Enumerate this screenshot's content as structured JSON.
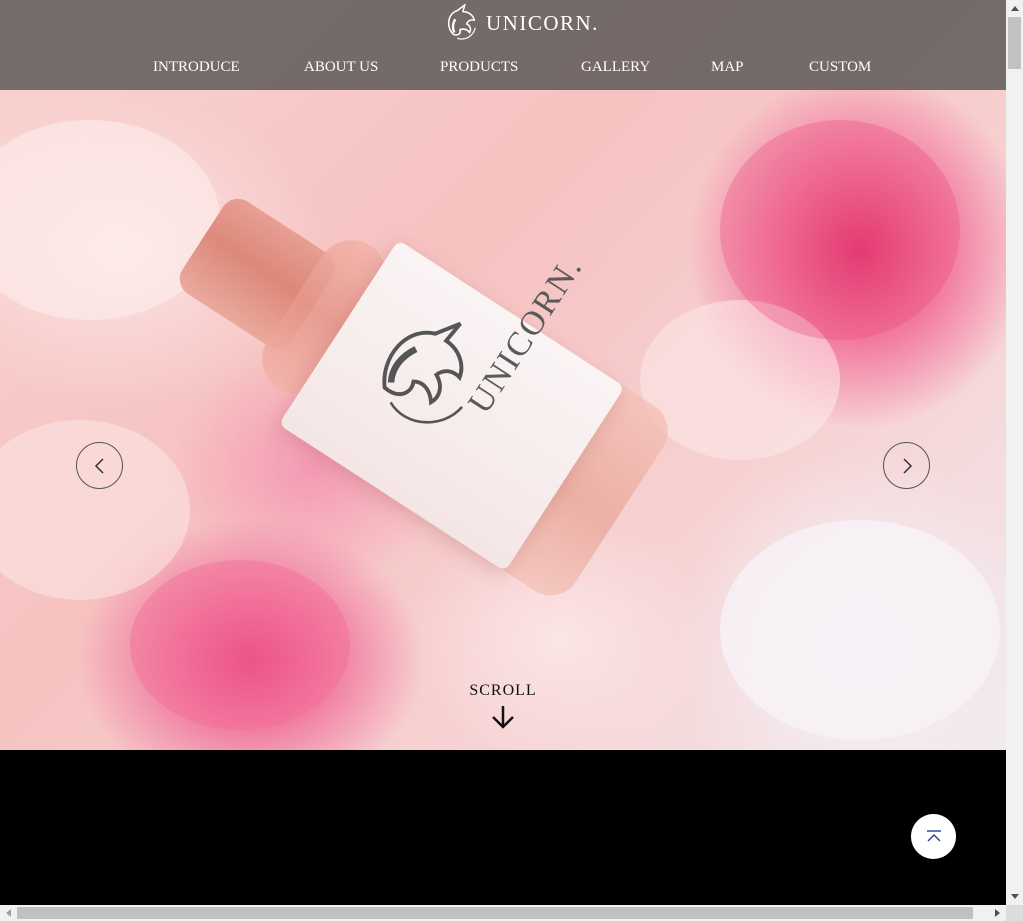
{
  "brand": {
    "name": "UNICORN.",
    "logo_icon": "unicorn-head-icon"
  },
  "nav": {
    "items": [
      {
        "label": "INTRODUCE"
      },
      {
        "label": "ABOUT US"
      },
      {
        "label": "PRODUCTS"
      },
      {
        "label": "GALLERY"
      },
      {
        "label": "MAP"
      },
      {
        "label": "CUSTOM"
      }
    ]
  },
  "hero": {
    "product_label_text": "UNICORN.",
    "prev_icon": "chevron-left-icon",
    "next_icon": "chevron-right-icon",
    "scroll_text": "SCROLL",
    "scroll_icon": "arrow-down-icon"
  },
  "back_to_top": {
    "icon": "back-to-top-icon",
    "color": "#2b3a9a"
  },
  "colors": {
    "header_bg": "#505050",
    "page_bg": "#000000",
    "accent": "#2b3a9a"
  }
}
